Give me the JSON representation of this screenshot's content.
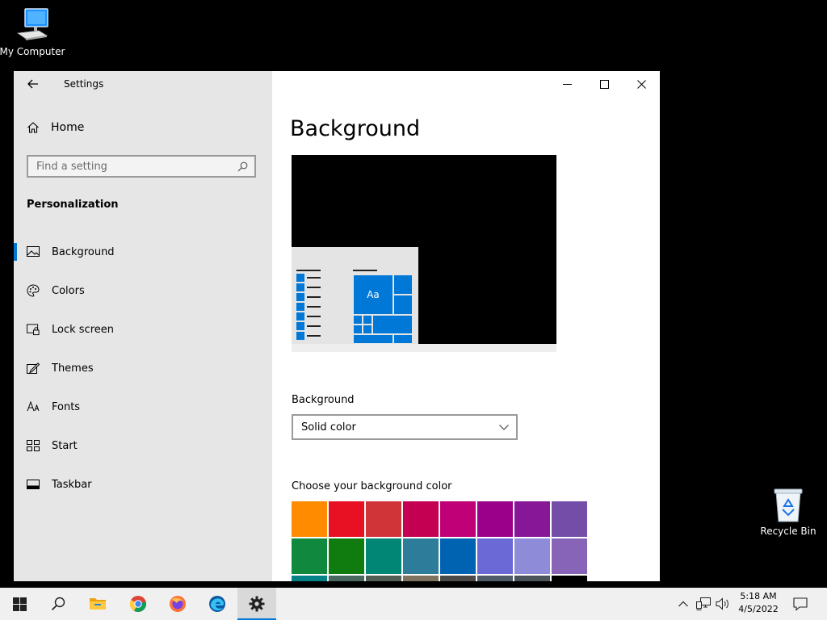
{
  "desktop": {
    "icons": [
      {
        "label": "My Computer",
        "icon": "computer-icon"
      },
      {
        "label": "Recycle Bin",
        "icon": "recycle-bin-icon"
      }
    ]
  },
  "window": {
    "title": "Settings",
    "controls": {
      "minimize": "minimize-icon",
      "maximize": "maximize-icon",
      "close": "close-icon"
    }
  },
  "sidebar": {
    "home_label": "Home",
    "search_placeholder": "Find a setting",
    "section": "Personalization",
    "items": [
      {
        "label": "Background",
        "icon": "image-icon",
        "selected": true
      },
      {
        "label": "Colors",
        "icon": "palette-icon"
      },
      {
        "label": "Lock screen",
        "icon": "lock-screen-icon"
      },
      {
        "label": "Themes",
        "icon": "themes-icon"
      },
      {
        "label": "Fonts",
        "icon": "fonts-icon"
      },
      {
        "label": "Start",
        "icon": "start-icon"
      },
      {
        "label": "Taskbar",
        "icon": "taskbar-icon"
      }
    ]
  },
  "main": {
    "title": "Background",
    "preview": {
      "tile_text": "Aa",
      "accent": "#0078d7",
      "background_color": "#000000"
    },
    "background_label": "Background",
    "background_value": "Solid color",
    "choose_label": "Choose your background color",
    "colors": [
      "#ff8c00",
      "#e81123",
      "#d13438",
      "#c30052",
      "#bf0077",
      "#9a0089",
      "#881798",
      "#744da9",
      "#10893e",
      "#107c10",
      "#018574",
      "#2d7d9a",
      "#0063b1",
      "#6b69d6",
      "#8e8cd8",
      "#8764b8",
      "#038387",
      "#486860",
      "#525e54",
      "#7e735f",
      "#4c4a48",
      "#515c6b",
      "#4a5459",
      "#000000"
    ]
  },
  "taskbar": {
    "clock_time": "5:18 AM",
    "clock_date": "4/5/2022",
    "accent": "#0078d7"
  }
}
